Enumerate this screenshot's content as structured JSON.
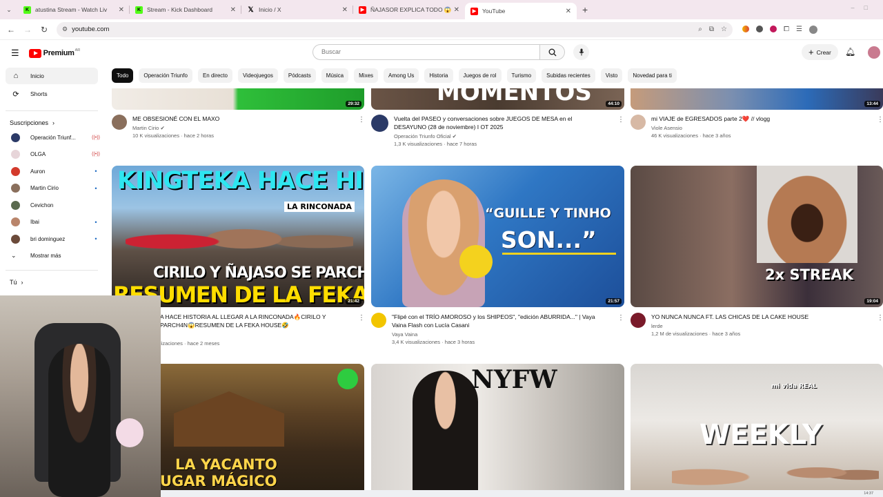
{
  "browser": {
    "tabs": [
      {
        "title": "atustina Stream - Watch Liv",
        "favicon": "kick-icon",
        "color": "#53fc18"
      },
      {
        "title": "Stream - Kick Dashboard",
        "favicon": "kick-icon",
        "color": "#53fc18"
      },
      {
        "title": "Inicio / X",
        "favicon": "x-icon",
        "color": "#000000"
      },
      {
        "title": "ÑAJASOR EXPLICA TODO 😱 ",
        "favicon": "youtube-icon",
        "color": "#ff0000"
      },
      {
        "title": "YouTube",
        "favicon": "youtube-icon",
        "color": "#ff0000"
      }
    ],
    "url": "youtube.com"
  },
  "yt": {
    "logo_text": "Premium",
    "region": "AR",
    "search_placeholder": "Buscar",
    "create_label": "Crear",
    "sidebar": {
      "inicio": "Inicio",
      "shorts": "Shorts",
      "subscriptions_label": "Suscripciones",
      "subscriptions": [
        {
          "name": "Operación Triunf...",
          "status": "live",
          "color": "#2b3a67"
        },
        {
          "name": "OLGA",
          "status": "live",
          "color": "#e7d5d9"
        },
        {
          "name": "Auron",
          "status": "new",
          "color": "#d33a2c"
        },
        {
          "name": "Martin Cirio",
          "status": "new",
          "color": "#8a6f5c"
        },
        {
          "name": "Cevichon",
          "status": "",
          "color": "#5a6a4e"
        },
        {
          "name": "Ibai",
          "status": "new",
          "color": "#b9856b"
        },
        {
          "name": "bri dominguez",
          "status": "new",
          "color": "#6b4a3a"
        }
      ],
      "show_more": "Mostrar más",
      "you_label": "Tú"
    },
    "chips": [
      "Todo",
      "Operación Triunfo",
      "En directo",
      "Videojuegos",
      "Pódcasts",
      "Música",
      "Mixes",
      "Among Us",
      "Historia",
      "Juegos de rol",
      "Turismo",
      "Subidas recientes",
      "Visto",
      "Novedad para ti"
    ],
    "videos_row1": [
      {
        "title": "ME OBSESIONÉ CON EL MAXO",
        "channel": "Martin Cirio",
        "stats": "10 K visualizaciones · hace 2 horas",
        "duration": "29:32",
        "avatar_color": "#8a6f5c"
      },
      {
        "title": "Vuelta del PASEO y conversaciones sobre JUEGOS DE MESA en el DESAYUNO (28 de noviembre) I OT 2025",
        "channel": "Operación Triunfo Oficial",
        "stats": "1,3 K visualizaciones · hace 7 horas",
        "duration": "44:10",
        "thumb_text": "MOMENTOS",
        "avatar_color": "#2b3a67"
      },
      {
        "title": "mi VIAJE de EGRESADOS parte 2❤️ // vlogg",
        "channel": "Viole Asensio",
        "stats": "46 K visualizaciones · hace 3 años",
        "duration": "13:44",
        "avatar_color": "#d7b9a5"
      }
    ],
    "videos_row2": [
      {
        "title": "KINGTEKA HACE HISTORIA AL LLEGAR A LA RINCONADA🔥CIRILO Y ÑAJASOR SE PARCHAN😱RESUMEN DE LA FEKA HOUSE🤣",
        "title_visible": "A HACE HISTORIA AL LLEGAR A LA RINCONADA🔥CIRILO Y PARCH4N😱RESUMEN DE LA FEKA HOUSE🤣",
        "stats": "lizaciones · hace 2 meses",
        "duration": "21:42",
        "thumb_top": "KINGTEKA HACE HISTORIA",
        "thumb_tag": "LA RINCONADA",
        "thumb_mid": "CIRILO Y ÑAJASO SE PARCHAN",
        "thumb_bottom": "RESUMEN DE LA FEKA HOUSE"
      },
      {
        "title": "\"Flipé con el TRÍO AMOROSO y los SHIPEOS\", \"edición ABURRIDA...\" | Vaya Vaina Flash con Lucía Casani",
        "channel": "Vaya Vaina",
        "stats": "3,4 K visualizaciones · hace 3 horas",
        "duration": "21:57",
        "thumb_text1": "“GUILLE Y TINHO",
        "thumb_text2": "SON...”",
        "avatar_color": "#f2c500"
      },
      {
        "title": "YO NUNCA NUNCA FT. LAS CHICAS DE LA CAKE HOUSE",
        "channel": "lerde",
        "stats": "1,2 M de visualizaciones · hace 3 años",
        "duration": "19:04",
        "thumb_text": "2x STREAK",
        "avatar_color": "#7a1a2a"
      }
    ],
    "videos_row3": [
      {
        "thumb_text1": "LA YACANTO",
        "thumb_text2": "UGAR MÁGICO"
      },
      {
        "thumb_text": "NYFW"
      },
      {
        "thumb_text": "WEEKLY",
        "thumb_small": "mi vida REAL"
      }
    ]
  },
  "taskbar": {
    "time": "14:37"
  }
}
